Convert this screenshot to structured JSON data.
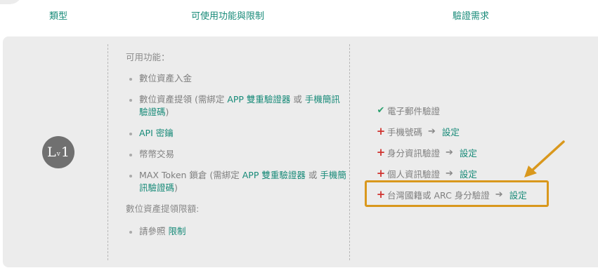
{
  "header": {
    "type_label": "類型",
    "func_label": "可使用功能與限制",
    "verify_label": "驗證需求"
  },
  "level": {
    "l": "L",
    "v": "v",
    "n": "1"
  },
  "functions": {
    "heading": "可用功能：",
    "items": {
      "deposit": "數位資產入金",
      "withdraw_a": "數位資產提領 (需綁定 ",
      "withdraw_link1": "APP 雙重驗證器",
      "withdraw_or": " 或 ",
      "withdraw_link2": "手機簡訊驗證碼",
      "withdraw_b": ")",
      "api": "API 密鑰",
      "coin_trade": "幣幣交易",
      "max_a": "MAX Token 鎖倉 (需綁定 ",
      "max_link1": "APP 雙重驗證器",
      "max_or": " 或 ",
      "max_link2": "手機簡訊驗證碼",
      "max_b": ")"
    },
    "limit_heading": "數位資產提領限額:",
    "limit_item_text": "請參照 ",
    "limit_item_link": "限制"
  },
  "verify": {
    "email": "電子郵件驗證",
    "phone": "手機號碼",
    "identity": "身分資訊驗證",
    "personal": "個人資訊驗證",
    "national_id": "台灣國籍或 ARC 身分驗證",
    "set_label": "設定"
  },
  "colors": {
    "accent": "#178a78",
    "check": "#2aa06e",
    "plus": "#d0312d",
    "highlight": "#d9981d",
    "card_bg": "#ececec"
  }
}
